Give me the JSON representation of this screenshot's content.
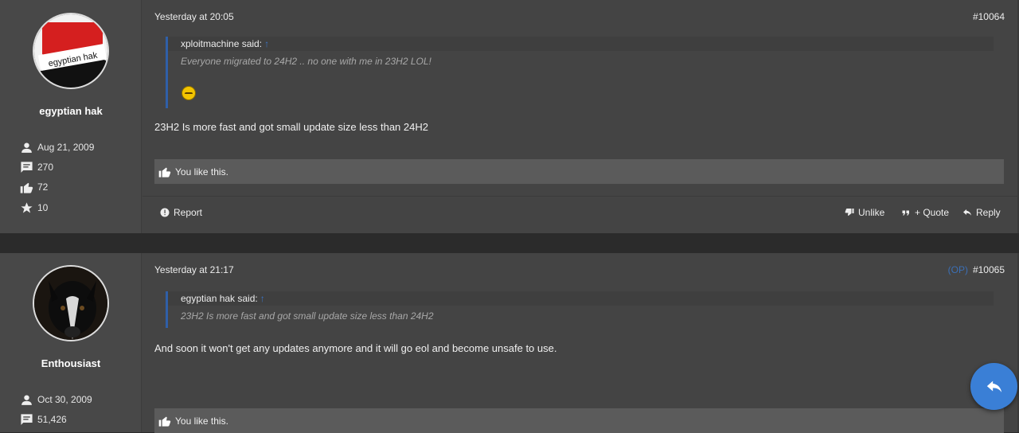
{
  "posts": [
    {
      "user": {
        "name": "egyptian hak",
        "avatar_text": "egyptian hak",
        "joined": "Aug 21, 2009",
        "messages": "270",
        "reactions": "72",
        "points": "10"
      },
      "date": "Yesterday at 20:05",
      "op_label": "",
      "number": "#10064",
      "quote": {
        "author": "xploitmachine said:",
        "arrow": "↑",
        "text": "Everyone migrated to 24H2 .. no one with me in 23H2 LOL!"
      },
      "message": "23H2 Is more fast and got small update size less than 24H2",
      "likes_text": "You like this.",
      "actions": {
        "report": "Report",
        "unlike": "Unlike",
        "quote": "+ Quote",
        "reply": "Reply"
      }
    },
    {
      "user": {
        "name": "Enthousiast",
        "joined": "Oct 30, 2009",
        "messages": "51,426"
      },
      "date": "Yesterday at 21:17",
      "op_label": "(OP)",
      "number": "#10065",
      "quote": {
        "author": "egyptian hak said:",
        "arrow": "↑",
        "text": "23H2 Is more fast and got small update size less than 24H2"
      },
      "message": "And soon it won't get any updates anymore and it will go eol and become unsafe to use.",
      "likes_text": "You like this."
    }
  ],
  "icons": {
    "person": "person-icon",
    "messages": "message-icon",
    "reactions": "thumbs-up-icon",
    "points": "star-icon",
    "reply_fab": "reply-icon"
  },
  "colors": {
    "accent": "#3a7fd6",
    "quote_border": "#2f5fa8",
    "post_bg": "#444444"
  }
}
